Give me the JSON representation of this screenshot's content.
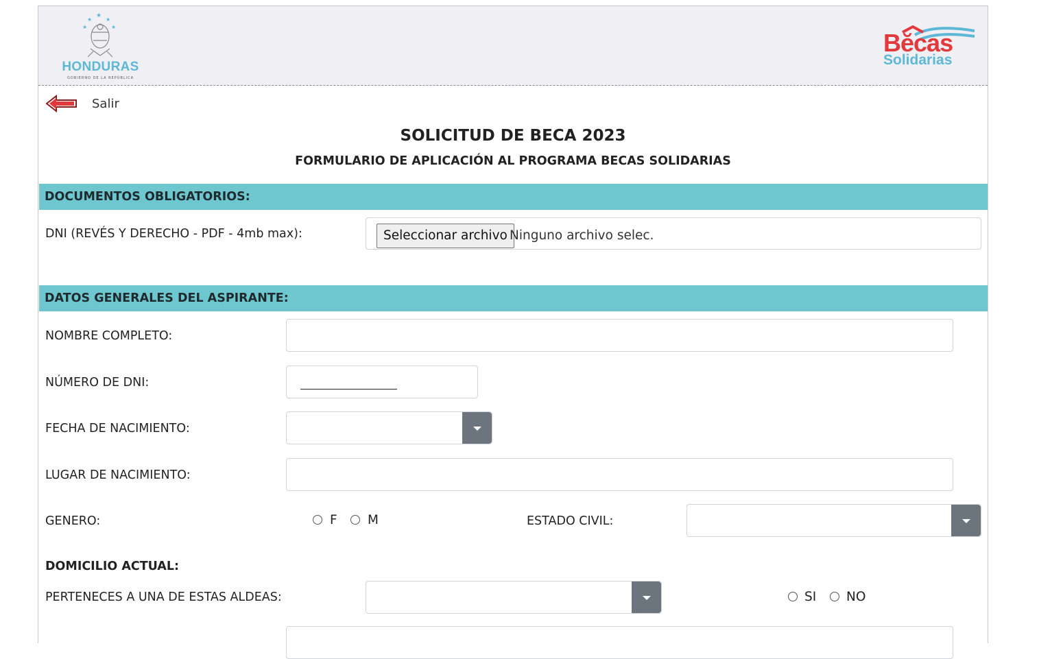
{
  "header": {
    "left_logo_text": "HONDURAS",
    "left_logo_subtext": "GOBIERNO DE LA REPÚBLICA",
    "right_logo_line1": "Bĕcas",
    "right_logo_line2": "Solidarias"
  },
  "nav": {
    "back_label": "Salir"
  },
  "form": {
    "title": "SOLICITUD DE BECA 2023",
    "subtitle": "FORMULARIO DE APLICACIÓN AL PROGRAMA BECAS SOLIDARIAS"
  },
  "documents": {
    "section_title": "DOCUMENTOS OBLIGATORIOS:",
    "dni_label": "DNI (REVÉS Y DERECHO - PDF - 4mb max):",
    "file_button": "Seleccionar archivo",
    "file_status": "Ninguno archivo selec."
  },
  "general": {
    "section_title": "DATOS GENERALES DEL ASPIRANTE:",
    "nombre_label": "NOMBRE COMPLETO:",
    "nombre_value": "",
    "dni_label": "NÚMERO DE DNI:",
    "nacimiento_label": "FECHA DE NACIMIENTO:",
    "lugar_label": "LUGAR DE NACIMIENTO:",
    "lugar_value": "",
    "genero_label": "GENERO:",
    "genero_options": [
      "F",
      "M"
    ],
    "estado_civil_label": "ESTADO CIVIL:",
    "domicilio_label": "DOMICILIO ACTUAL:",
    "aldeas_label": "PERTENECES A UNA DE ESTAS ALDEAS:",
    "aldeas_options": [
      "SI",
      "NO"
    ]
  },
  "colors": {
    "section_bg": "#6ec6cf",
    "header_bg": "#f0eff4",
    "dropdown_btn": "#6c757d",
    "brand_red": "#e2393d",
    "brand_blue": "#5cb8d6"
  }
}
